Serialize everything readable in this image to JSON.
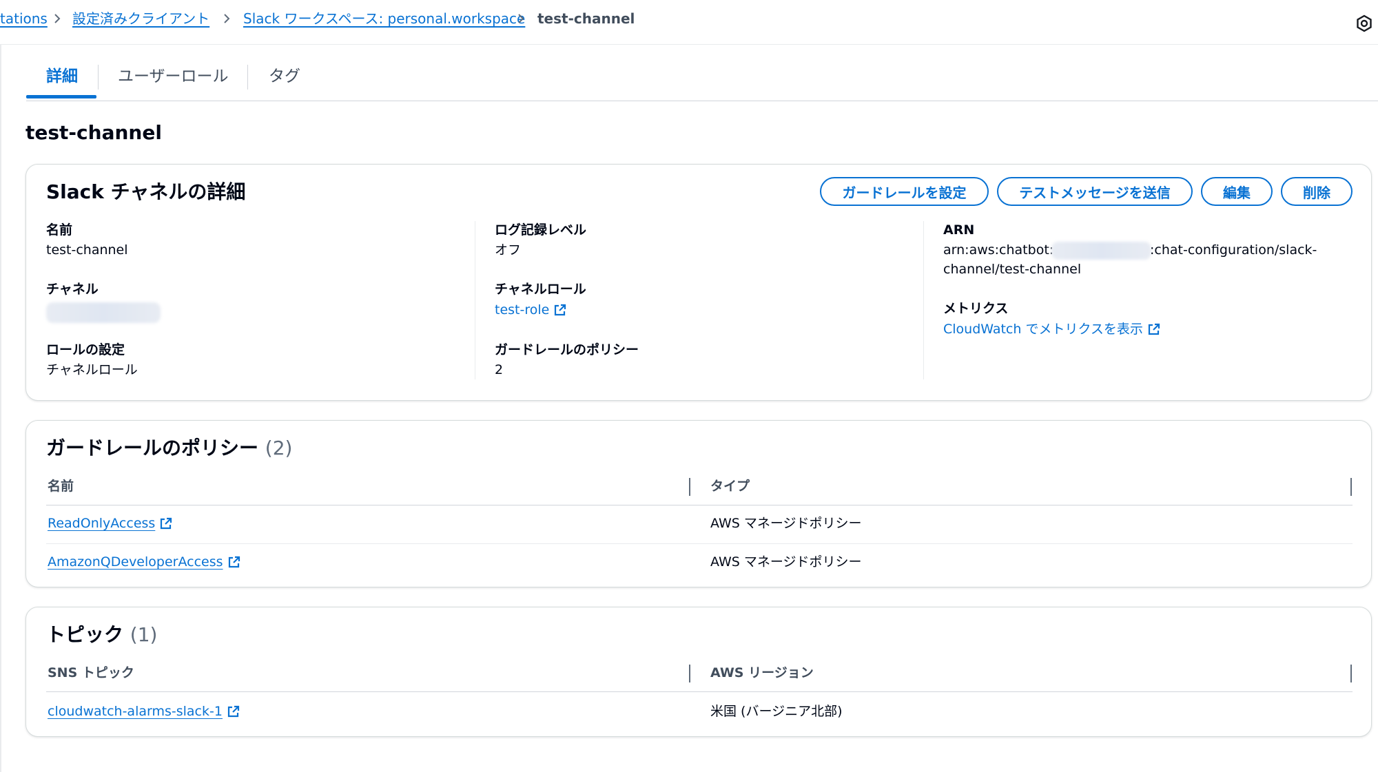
{
  "breadcrumb": {
    "items": [
      "tations",
      "設定済みクライアント",
      "Slack ワークスペース: personal.workspace"
    ],
    "current": "test-channel"
  },
  "tabs": [
    "詳細",
    "ユーザーロール",
    "タグ"
  ],
  "page_title": "test-channel",
  "details": {
    "title": "Slack チャネルの詳細",
    "buttons": {
      "guardrail": "ガードレールを設定",
      "test_message": "テストメッセージを送信",
      "edit": "編集",
      "delete": "削除"
    },
    "name_label": "名前",
    "name_value": "test-channel",
    "channel_label": "チャネル",
    "role_setting_label": "ロールの設定",
    "role_setting_value": "チャネルロール",
    "log_level_label": "ログ記録レベル",
    "log_level_value": "オフ",
    "channel_role_label": "チャネルロール",
    "channel_role_value": "test-role",
    "guardrail_policy_label": "ガードレールのポリシー",
    "guardrail_policy_value": "2",
    "arn_label": "ARN",
    "arn_line1_prefix": "arn:aws:chatbot::",
    "arn_line1_suffix": ":chat-configuration/slack-",
    "arn_line2": "channel/test-channel",
    "metrics_label": "メトリクス",
    "metrics_link": "CloudWatch でメトリクスを表示"
  },
  "guardrails": {
    "title": "ガードレールのポリシー",
    "count": "(2)",
    "col_name": "名前",
    "col_type": "タイプ",
    "rows": [
      {
        "name": "ReadOnlyAccess",
        "type": "AWS マネージドポリシー"
      },
      {
        "name": "AmazonQDeveloperAccess",
        "type": "AWS マネージドポリシー"
      }
    ]
  },
  "topics": {
    "title": "トピック",
    "count": "(1)",
    "col_topic": "SNS トピック",
    "col_region": "AWS リージョン",
    "rows": [
      {
        "topic": "cloudwatch-alarms-slack-1",
        "region": "米国 (バージニア北部)"
      }
    ]
  },
  "icons": {
    "breadcrumb_separator": "chevron-right-icon",
    "external_link": "external-link-icon",
    "corner": "settings-icon"
  },
  "colors": {
    "link": "#0972d3",
    "text": "#000716",
    "muted": "#414d5c"
  }
}
